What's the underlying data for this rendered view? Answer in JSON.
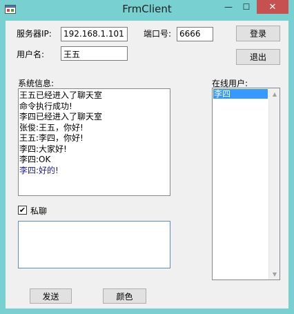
{
  "window": {
    "title": "FrmClient"
  },
  "titlebar": {
    "minimize": "—",
    "maximize": "☐",
    "close": "✕"
  },
  "server": {
    "label": "服务器IP:",
    "value": "192.168.1.101"
  },
  "port": {
    "label": "端口号:",
    "value": "6666"
  },
  "username": {
    "label": "用户名:",
    "value": "王五"
  },
  "buttons": {
    "login": "登录",
    "logout": "退出",
    "send": "发送",
    "color": "颜色"
  },
  "system_info": {
    "label": "系统信息:",
    "messages": [
      {
        "text": "王五已经进入了聊天室",
        "color": "#000000"
      },
      {
        "text": "命令执行成功!",
        "color": "#000000"
      },
      {
        "text": "李四已经进入了聊天室",
        "color": "#000000"
      },
      {
        "text": "张俊:王五，你好!",
        "color": "#000000"
      },
      {
        "text": "王五:李四，你好!",
        "color": "#000000"
      },
      {
        "text": "李四:大家好!",
        "color": "#000000"
      },
      {
        "text": "李四:OK",
        "color": "#000000"
      },
      {
        "text": "李四:好的!",
        "color": "#1a1aa6"
      }
    ]
  },
  "online_users": {
    "label": "在线用户:",
    "items": [
      "李四"
    ],
    "selected": "李四",
    "selection_color": "#3399ff"
  },
  "private_chat": {
    "label": "私聊",
    "checked": true,
    "check_glyph": "✔"
  },
  "message_input": {
    "value": ""
  }
}
